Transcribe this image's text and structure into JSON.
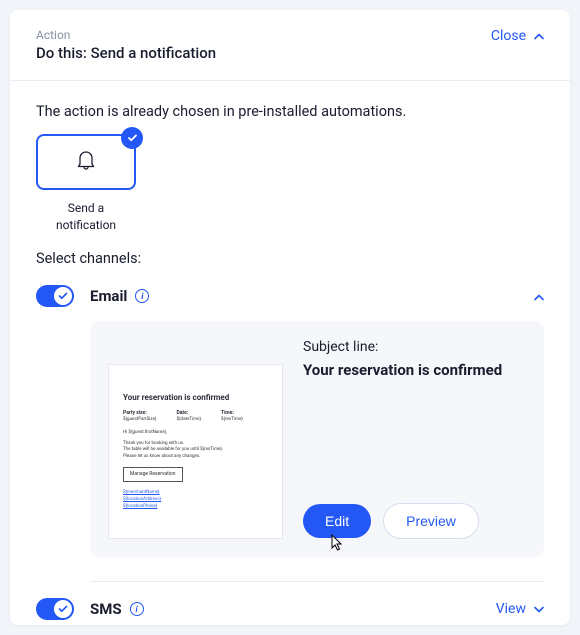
{
  "header": {
    "eyebrow": "Action",
    "title": "Do this: Send a notification",
    "close": "Close"
  },
  "intro": "The action is already chosen in pre-installed automations.",
  "action_tile": {
    "line1": "Send a",
    "line2": "notification"
  },
  "select_channels_label": "Select channels:",
  "channels": {
    "email": {
      "name": "Email"
    },
    "sms": {
      "name": "SMS",
      "view": "View"
    }
  },
  "email_panel": {
    "subject_label": "Subject line:",
    "subject_value": "Your reservation is confirmed",
    "edit": "Edit",
    "preview": "Preview"
  },
  "thumb": {
    "title": "Your reservation is confirmed",
    "party_label": "Party size:",
    "party_value": "${guestPartSize}",
    "date_label": "Date:",
    "date_value": "${dateTime}",
    "time_label": "Time:",
    "time_value": "${resTime}",
    "greeting": "Hi ${guest.firstName},",
    "body1": "Thank you for booking with us.",
    "body2": "The table will be available for you until ${resTime}.",
    "body3": "Please let us know about any changes.",
    "button": "Manage Reservation",
    "f1": "${merchantName}",
    "f2": "${locationAddress}",
    "f3": "${locationPhone}"
  }
}
